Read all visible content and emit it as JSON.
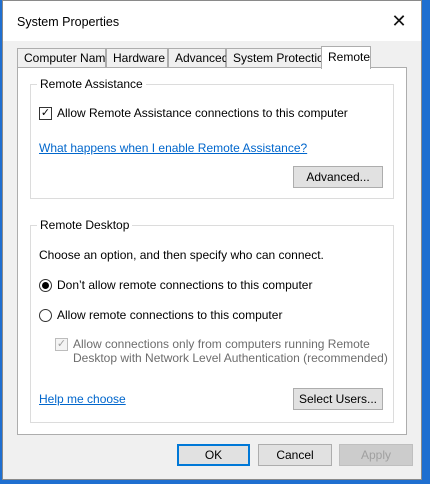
{
  "window": {
    "title": "System Properties"
  },
  "tabs": [
    {
      "label": "Computer Name"
    },
    {
      "label": "Hardware"
    },
    {
      "label": "Advanced"
    },
    {
      "label": "System Protection"
    },
    {
      "label": "Remote"
    }
  ],
  "remote_assistance": {
    "heading": "Remote Assistance",
    "allow_checkbox": {
      "label": "Allow Remote Assistance connections to this computer",
      "checked": true
    },
    "help_link": "What happens when I enable Remote Assistance?",
    "advanced_button": "Advanced..."
  },
  "remote_desktop": {
    "heading": "Remote Desktop",
    "instruction": "Choose an option, and then specify who can connect.",
    "option_dont_allow": {
      "label": "Don’t allow remote connections to this computer",
      "selected": true
    },
    "option_allow": {
      "label": "Allow remote connections to this computer",
      "selected": false
    },
    "nla_checkbox": {
      "line1": "Allow connections only from computers running Remote",
      "line2": "Desktop with Network Level Authentication (recommended)",
      "checked": true,
      "enabled": false
    },
    "help_link": "Help me choose",
    "select_users_button": "Select Users..."
  },
  "footer": {
    "ok": "OK",
    "cancel": "Cancel",
    "apply": "Apply"
  },
  "icons": {
    "close": "close-icon",
    "checkmark": "checkmark-icon"
  }
}
